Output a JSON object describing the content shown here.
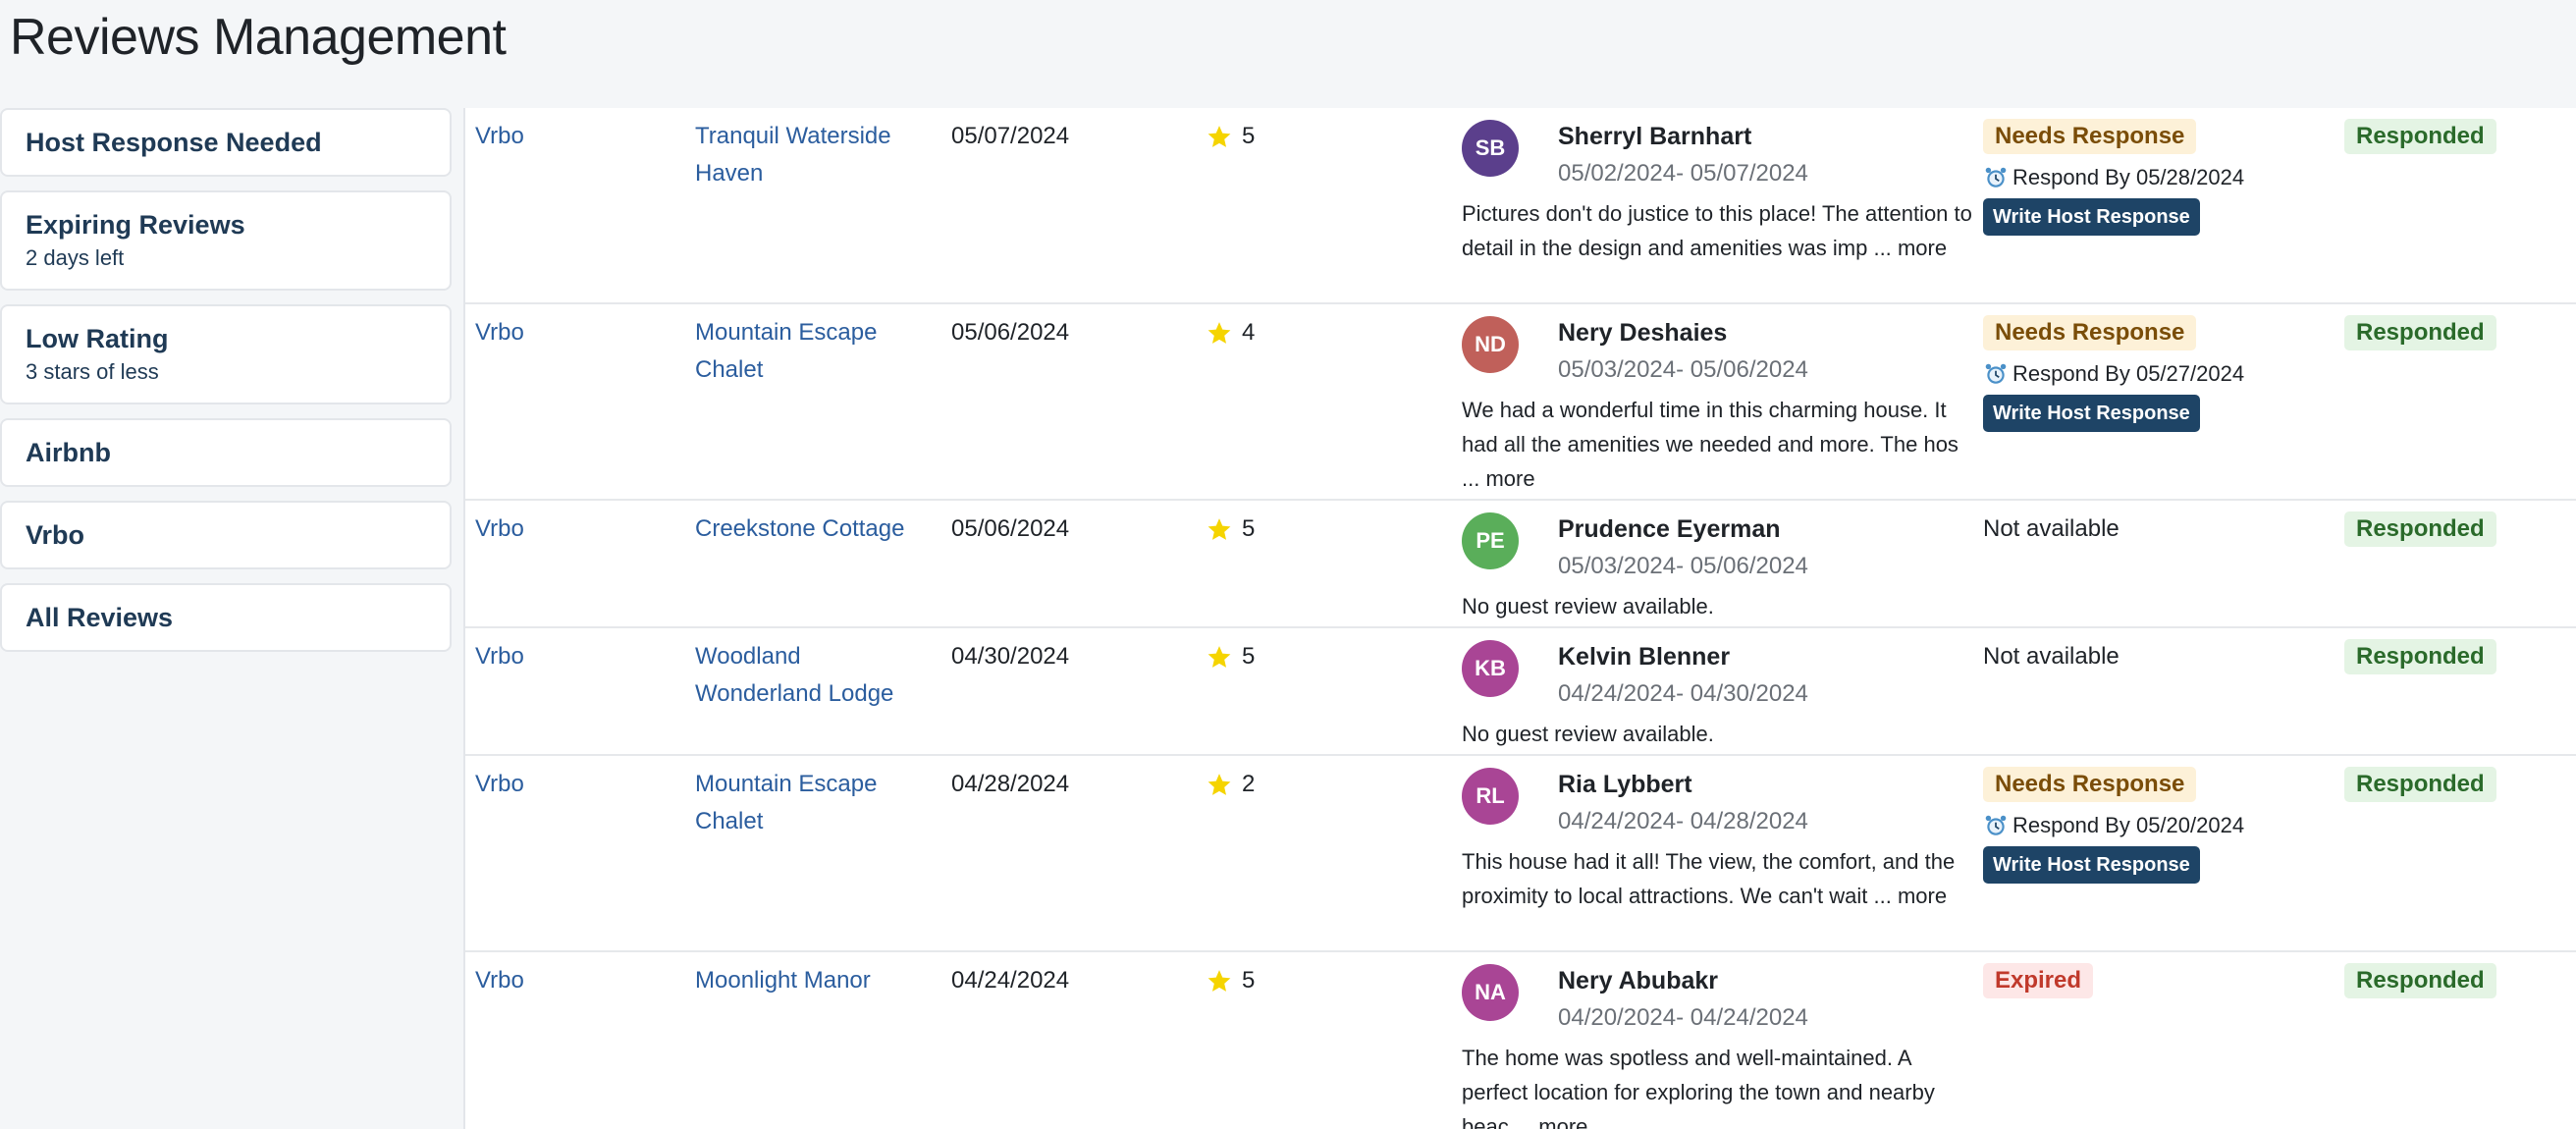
{
  "page_title": "Reviews Management",
  "filters": [
    {
      "title": "Host Response Needed",
      "subtitle": ""
    },
    {
      "title": "Expiring Reviews",
      "subtitle": "2 days left"
    },
    {
      "title": "Low Rating",
      "subtitle": "3 stars of less"
    },
    {
      "title": "Airbnb",
      "subtitle": ""
    },
    {
      "title": "Vrbo",
      "subtitle": ""
    },
    {
      "title": "All Reviews",
      "subtitle": ""
    }
  ],
  "labels": {
    "more": "more",
    "write_response": "Write Host Response",
    "not_available": "Not available"
  },
  "colors": {
    "avatar_purple_dark": "#5b3f8c",
    "avatar_red": "#c0605a",
    "avatar_green": "#5aae5a",
    "avatar_magenta": "#a94595",
    "star": "#f5d400"
  },
  "rows": [
    {
      "source": "Vrbo",
      "property": "Tranquil Waterside Haven",
      "date": "05/07/2024",
      "rating": "5",
      "initials": "SB",
      "avatar_color": "#5b3f8c",
      "guest": "Sherryl Barnhart",
      "stay": "05/02/2024- 05/07/2024",
      "review": "Pictures don't do justice to this place! The attention to detail in the design and amenities was imp ...",
      "response_badge": "Needs Response",
      "respond_by": "Respond By 05/28/2024",
      "status": "Responded"
    },
    {
      "source": "Vrbo",
      "property": "Mountain Escape Chalet",
      "date": "05/06/2024",
      "rating": "4",
      "initials": "ND",
      "avatar_color": "#c0605a",
      "guest": "Nery Deshaies",
      "stay": "05/03/2024- 05/06/2024",
      "review": "We had a wonderful time in this charming house. It had all the amenities we needed and more. The hos ...",
      "response_badge": "Needs Response",
      "respond_by": "Respond By 05/27/2024",
      "status": "Responded"
    },
    {
      "source": "Vrbo",
      "property": "Creekstone Cottage",
      "date": "05/06/2024",
      "rating": "5",
      "initials": "PE",
      "avatar_color": "#5aae5a",
      "guest": "Prudence Eyerman",
      "stay": "05/03/2024- 05/06/2024",
      "review": "No guest review available.",
      "response_text": "Not available",
      "status": "Responded"
    },
    {
      "source": "Vrbo",
      "property": "Woodland Wonderland Lodge",
      "date": "04/30/2024",
      "rating": "5",
      "initials": "KB",
      "avatar_color": "#a94595",
      "guest": "Kelvin Blenner",
      "stay": "04/24/2024- 04/30/2024",
      "review": "No guest review available.",
      "response_text": "Not available",
      "status": "Responded"
    },
    {
      "source": "Vrbo",
      "property": "Mountain Escape Chalet",
      "date": "04/28/2024",
      "rating": "2",
      "initials": "RL",
      "avatar_color": "#a94595",
      "guest": "Ria Lybbert",
      "stay": "04/24/2024- 04/28/2024",
      "review": "This house had it all! The view, the comfort, and the proximity to local attractions. We can't wait ...",
      "response_badge": "Needs Response",
      "respond_by": "Respond By 05/20/2024",
      "status": "Responded"
    },
    {
      "source": "Vrbo",
      "property": "Moonlight Manor",
      "date": "04/24/2024",
      "rating": "5",
      "initials": "NA",
      "avatar_color": "#a94595",
      "guest": "Nery Abubakr",
      "stay": "04/20/2024- 04/24/2024",
      "review": "The home was spotless and well-maintained. A perfect location for exploring the town and nearby beac ...",
      "response_badge": "Expired",
      "status": "Responded"
    }
  ]
}
